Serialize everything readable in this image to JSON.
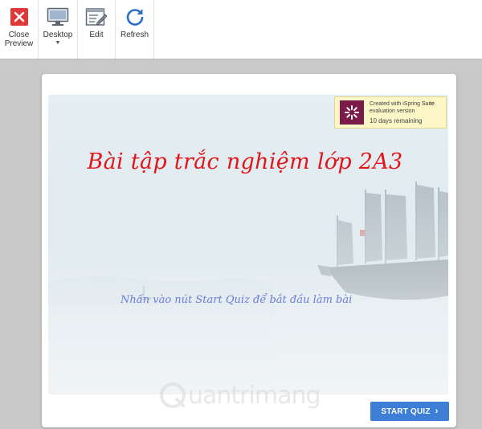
{
  "toolbar": {
    "close_label_1": "Close",
    "close_label_2": "Preview",
    "desktop_label": "Desktop",
    "edit_label": "Edit",
    "refresh_label": "Refresh"
  },
  "slide": {
    "title": "Bài tập trắc nghiệm lớp 2A3",
    "subtitle": "Nhấn vào nút Start Quiz để  bắt đầu làm bài"
  },
  "ispring_badge": {
    "line1_prefix": "Created with iSpring ",
    "line1_brand": "Suite",
    "line2": "evaluation version",
    "remaining": "10 days remaining"
  },
  "watermark": {
    "text": "uantrimang"
  },
  "start_button": {
    "label": "START QUIZ",
    "chevron": "›"
  },
  "colors": {
    "title_red": "#e0161b",
    "subtitle_blue": "#6a7bd9",
    "button_blue": "#3d7ed6",
    "badge_bg": "#fdf6c6",
    "logo_purple": "#7a1c49",
    "close_red": "#e03838",
    "refresh_blue": "#2a6ec6"
  }
}
